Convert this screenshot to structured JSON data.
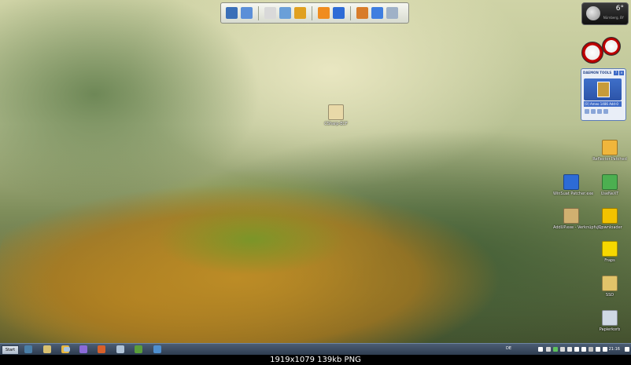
{
  "desktop": {
    "icons": [
      {
        "label": "CSharp-ECF",
        "color": "#e9d9a8",
        "glyph": "file-icon"
      },
      {
        "label": "Reflector.Patched",
        "color": "#f0b63c",
        "glyph": "gears-icon"
      },
      {
        "label": "WinSuat Patcher.exe",
        "color": "#2d6bd6",
        "glyph": "globe-icon"
      },
      {
        "label": "UseNeXT",
        "color": "#4caf50",
        "glyph": "usenext-icon"
      },
      {
        "label": "AddUP.exe - Verknüpfung",
        "color": "#d0b070",
        "glyph": "app-icon"
      },
      {
        "label": "JDownloader",
        "color": "#f2c200",
        "glyph": "jd-icon"
      },
      {
        "label": "Fraps",
        "color": "#f6d800",
        "glyph": "fraps-icon"
      },
      {
        "label": "SSD",
        "color": "#e2c46a",
        "glyph": "folder-icon"
      },
      {
        "label": "Papierkorb",
        "color": "#cfd8e4",
        "glyph": "recycle-bin-icon"
      }
    ]
  },
  "quicklaunch": {
    "items": [
      {
        "name": "computer",
        "color": "#3a6fb8"
      },
      {
        "name": "network",
        "color": "#5b8fd8"
      },
      {
        "name": "documents",
        "color": "#d9d9d9"
      },
      {
        "name": "pictures",
        "color": "#6a9fd8"
      },
      {
        "name": "music",
        "color": "#e0a020"
      },
      {
        "name": "media-player",
        "color": "#f08c1e"
      },
      {
        "name": "settings",
        "color": "#2d6bd6"
      },
      {
        "name": "programs",
        "color": "#d87c2a"
      },
      {
        "name": "tools",
        "color": "#3f7ee0"
      },
      {
        "name": "recycle",
        "color": "#9fb1c7"
      }
    ]
  },
  "gadgets": {
    "weather": {
      "temperature": "6°",
      "subtitle": "Nürnberg, BY"
    },
    "daemon": {
      "title": "DAEMON TOOLS",
      "drive": "[0] Ameo 1486 Add-0"
    }
  },
  "taskbar": {
    "start_label": "Start",
    "items": [
      "#4a7fa8",
      "#d8c070",
      "#e6b640",
      "#a8c4e0",
      "#8a6ad8",
      "#d8602a",
      "#b0c4d8",
      "#5a9e3a",
      "#4e8fd0"
    ],
    "language": "DE",
    "time": "21:16",
    "tray_colors": [
      "#ffffff",
      "#d8d8d8",
      "#5ec05e",
      "#d8d8d8",
      "#e8e8e8",
      "#ffffff",
      "#ffffff",
      "#c0c0c0",
      "#ffffff",
      "#ffffff",
      "#ffffff"
    ]
  },
  "caption": "1919x1079  139kb  PNG"
}
